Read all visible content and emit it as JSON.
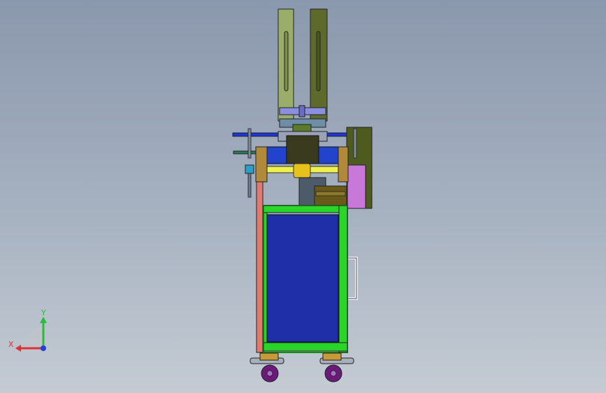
{
  "viewport": {
    "background_top": "#8a98ad",
    "background_bottom": "#c4cbd3"
  },
  "triad": {
    "x_label": "X",
    "y_label": "Y",
    "x_color": "#e03030",
    "y_color": "#2bbd3a",
    "z_color": "#2040e0"
  },
  "model": {
    "frame_color": "#2ad52a",
    "panel_color": "#1f2fa8",
    "upright_colors": [
      "#9aae6a",
      "#5d6a2c"
    ],
    "rail_color": "#f0f04a",
    "side_box_color": "#c878d8",
    "post_color": "#e07a70",
    "caster_wheel_color": "#6a1a7a"
  }
}
